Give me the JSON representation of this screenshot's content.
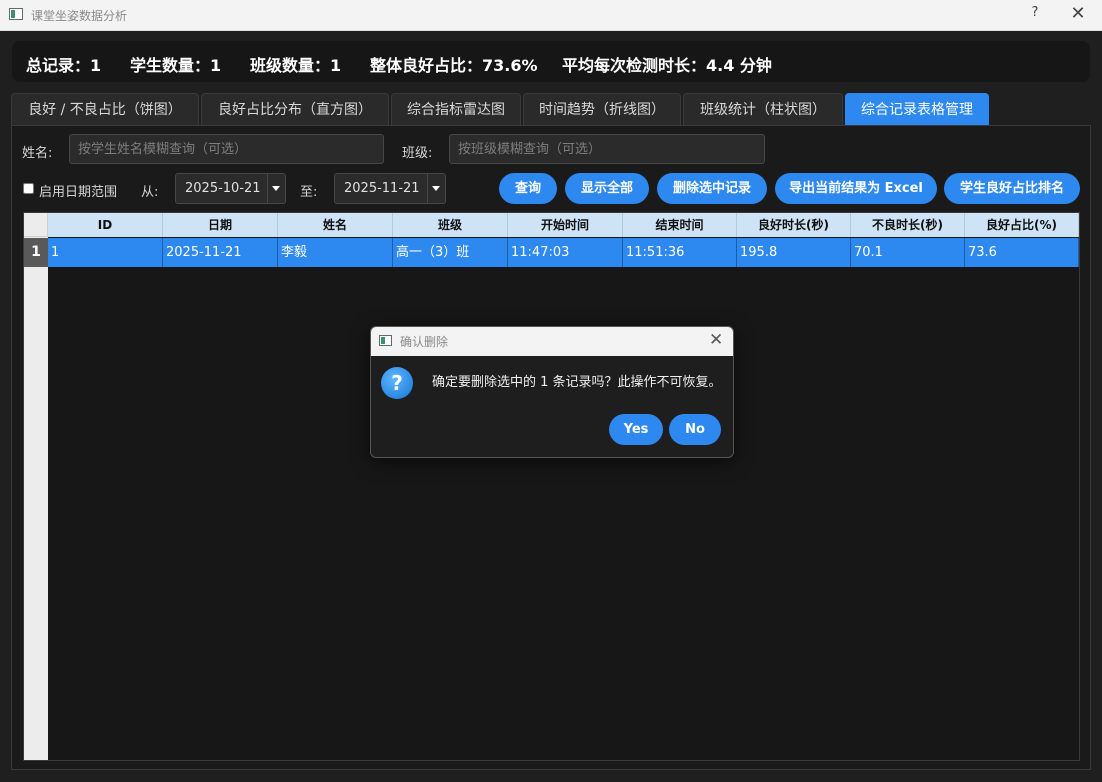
{
  "window": {
    "title": "课堂坐姿数据分析",
    "help": "?",
    "close": "✕"
  },
  "stats": [
    "总记录：1",
    "学生数量：1",
    "班级数量：1",
    "整体良好占比：73.6%",
    "平均每次检测时长：4.4 分钟"
  ],
  "tabs": [
    "良好 / 不良占比（饼图）",
    "良好占比分布（直方图）",
    "综合指标雷达图",
    "时间趋势（折线图）",
    "班级统计（柱状图）",
    "综合记录表格管理"
  ],
  "active_tab_index": 5,
  "filters": {
    "name_label": "姓名:",
    "name_placeholder": "按学生姓名模糊查询（可选）",
    "class_label": "班级:",
    "class_placeholder": "按班级模糊查询（可选）",
    "date_range_label": "启用日期范围",
    "date_range_checked": false,
    "from_label": "从:",
    "from_value": "2025-10-21",
    "to_label": "至:",
    "to_value": "2025-11-21"
  },
  "buttons": {
    "query": "查询",
    "show_all": "显示全部",
    "delete_selected": "删除选中记录",
    "export_excel": "导出当前结果为 Excel",
    "ranking": "学生良好占比排名"
  },
  "table": {
    "headers": [
      "ID",
      "日期",
      "姓名",
      "班级",
      "开始时间",
      "结束时间",
      "良好时长(秒)",
      "不良时长(秒)",
      "良好占比(%)"
    ],
    "rows": [
      {
        "num": "1",
        "cells": [
          "1",
          "2025-11-21",
          "李毅",
          "高一（3）班",
          "11:47:03",
          "11:51:36",
          "195.8",
          "70.1",
          "73.6"
        ]
      }
    ]
  },
  "dialog": {
    "title": "确认删除",
    "message": "确定要删除选中的 1 条记录吗？此操作不可恢复。",
    "icon": "question-icon",
    "yes": "Yes",
    "no": "No",
    "close": "✕"
  },
  "colors": {
    "accent": "#2d89ef",
    "background": "#1a1a1a",
    "header": "#cfe3f6"
  }
}
